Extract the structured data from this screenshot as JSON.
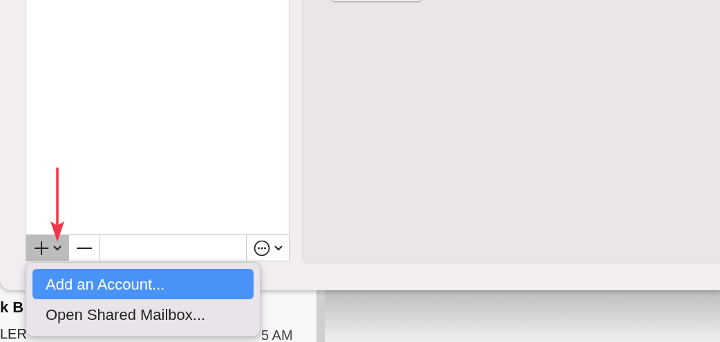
{
  "accounts_toolbar": {
    "add_button": {
      "expanded": true
    },
    "remove_button": {
      "disabled": false
    },
    "more_button": {
      "disabled": false
    }
  },
  "add_menu": {
    "items": [
      {
        "label": "Add an Account...",
        "selected": true
      },
      {
        "label": "Open Shared Mailbox...",
        "selected": false
      }
    ]
  },
  "message_list_behind": {
    "sender": "k B",
    "preview": "LER",
    "time": "5 AM"
  }
}
